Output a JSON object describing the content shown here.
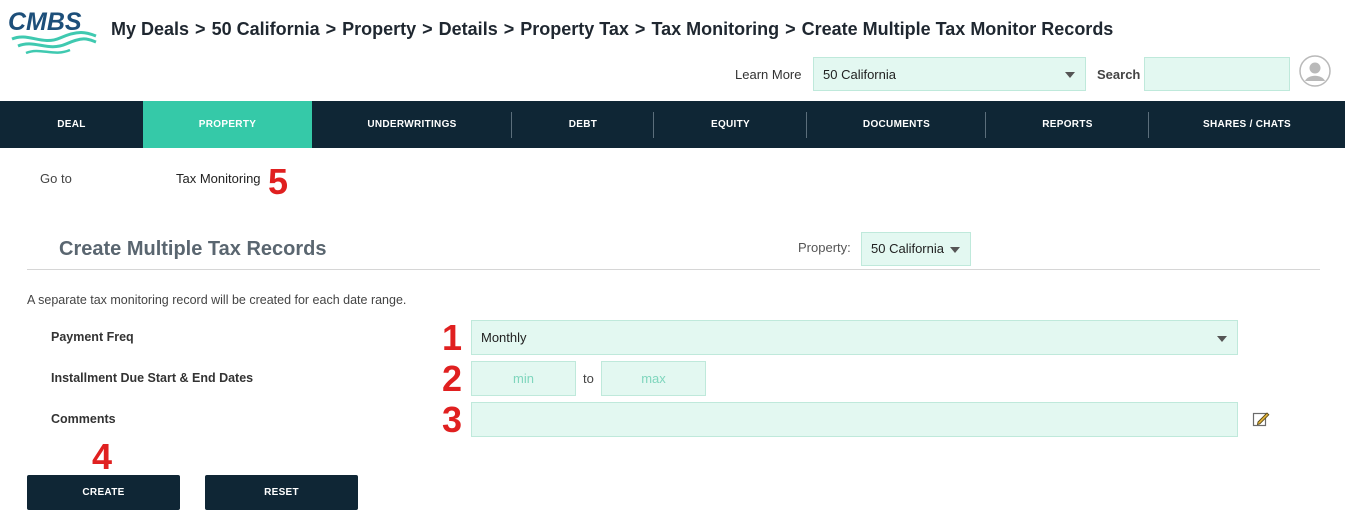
{
  "header": {
    "logo_text": "CMBS",
    "breadcrumb": [
      "My Deals",
      "50 California",
      "Property",
      "Details",
      "Property Tax",
      "Tax Monitoring",
      "Create Multiple Tax Monitor Records"
    ],
    "breadcrumb_sep": ">",
    "learn_more": "Learn More",
    "deal_select_value": "50 California",
    "search_label": "Search"
  },
  "nav": {
    "items": [
      "DEAL",
      "PROPERTY",
      "UNDERWRITINGS",
      "DEBT",
      "EQUITY",
      "DOCUMENTS",
      "REPORTS",
      "SHARES / CHATS"
    ],
    "active": "PROPERTY",
    "colors": {
      "bar": "#0f2635",
      "active": "#35c9a8"
    }
  },
  "goto": {
    "label": "Go to",
    "link": "Tax Monitoring"
  },
  "annotations": [
    "1",
    "2",
    "3",
    "4",
    "5"
  ],
  "section": {
    "title": "Create Multiple Tax Records",
    "property_label": "Property:",
    "property_value": "50 California",
    "note": "A separate tax monitoring record will be created for each date range."
  },
  "form": {
    "payment_freq_label": "Payment Freq",
    "payment_freq_value": "Monthly",
    "dates_label": "Installment Due Start & End Dates",
    "min_placeholder": "min",
    "to_label": "to",
    "max_placeholder": "max",
    "comments_label": "Comments"
  },
  "buttons": {
    "create": "CREATE",
    "reset": "RESET"
  }
}
